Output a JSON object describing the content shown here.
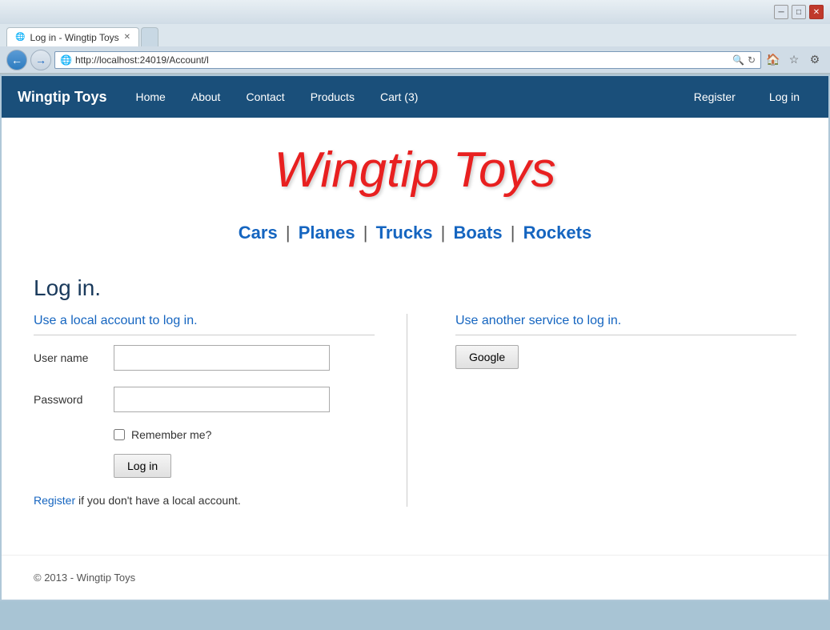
{
  "browser": {
    "title_bar": {
      "minimize_label": "─",
      "restore_label": "□",
      "close_label": "✕"
    },
    "tab": {
      "icon": "🌐",
      "label": "Log in - Wingtip Toys",
      "close": "✕"
    },
    "address_bar": {
      "url": "http://localhost:24019/Account/l",
      "search_icon": "🔍",
      "refresh_icon": "↻"
    },
    "toolbar_icons": [
      "🏠",
      "☆",
      "⚙"
    ]
  },
  "nav": {
    "brand": "Wingtip Toys",
    "links": [
      {
        "label": "Home"
      },
      {
        "label": "About"
      },
      {
        "label": "Contact"
      },
      {
        "label": "Products"
      },
      {
        "label": "Cart (3)"
      }
    ],
    "right_links": [
      {
        "label": "Register"
      },
      {
        "label": "Log in"
      }
    ]
  },
  "site_header": {
    "title": "Wingtip Toys"
  },
  "categories": {
    "items": [
      "Cars",
      "Planes",
      "Trucks",
      "Boats",
      "Rockets"
    ]
  },
  "login_page": {
    "page_title": "Log in.",
    "local_section_title": "Use a local account to log in.",
    "username_label": "User name",
    "password_label": "Password",
    "remember_label": "Remember me?",
    "login_button": "Log in",
    "register_hint": "if you don't have a local account.",
    "register_link_text": "Register",
    "service_section_title": "Use another service to log in.",
    "google_button": "Google"
  },
  "footer": {
    "text": "© 2013 - Wingtip Toys"
  }
}
